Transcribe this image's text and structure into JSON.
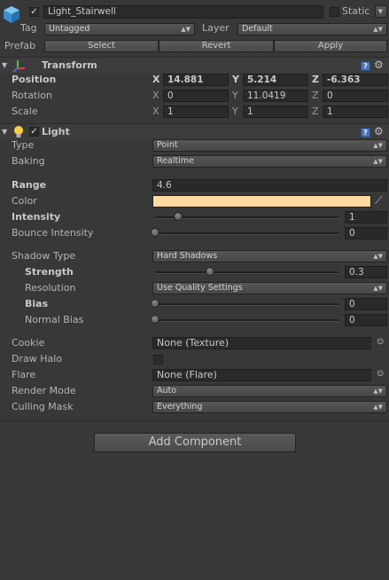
{
  "header": {
    "object_name": "Light_Stairwell",
    "static_label": "Static",
    "tag_label": "Tag",
    "tag_value": "Untagged",
    "layer_label": "Layer",
    "layer_value": "Default",
    "prefab_label": "Prefab",
    "prefab_buttons": [
      "Select",
      "Revert",
      "Apply"
    ]
  },
  "transform": {
    "title": "Transform",
    "rows": [
      {
        "label": "Position",
        "x": "14.881",
        "y": "5.214",
        "z": "-6.363"
      },
      {
        "label": "Rotation",
        "x": "0",
        "y": "11.0419",
        "z": "0"
      },
      {
        "label": "Scale",
        "x": "1",
        "y": "1",
        "z": "1"
      }
    ],
    "axes": [
      "X",
      "Y",
      "Z"
    ]
  },
  "light": {
    "title": "Light",
    "type_label": "Type",
    "type_value": "Point",
    "baking_label": "Baking",
    "baking_value": "Realtime",
    "range_label": "Range",
    "range_value": "4.6",
    "color_label": "Color",
    "color_value": "#ffd9a0",
    "intensity_label": "Intensity",
    "intensity_value": "1",
    "intensity_level": 0.125,
    "bounce_label": "Bounce Intensity",
    "bounce_value": "0",
    "bounce_level": 0,
    "shadow_type_label": "Shadow Type",
    "shadow_type_value": "Hard Shadows",
    "strength_label": "Strength",
    "strength_value": "0.3",
    "strength_level": 0.3,
    "resolution_label": "Resolution",
    "resolution_value": "Use Quality Settings",
    "bias_label": "Bias",
    "bias_value": "0",
    "bias_level": 0,
    "normal_bias_label": "Normal Bias",
    "normal_bias_value": "0",
    "normal_bias_level": 0,
    "cookie_label": "Cookie",
    "cookie_value": "None (Texture)",
    "draw_halo_label": "Draw Halo",
    "flare_label": "Flare",
    "flare_value": "None (Flare)",
    "render_mode_label": "Render Mode",
    "render_mode_value": "Auto",
    "culling_mask_label": "Culling Mask",
    "culling_mask_value": "Everything"
  },
  "add_component_label": "Add Component",
  "icons": {
    "object": "cube-icon",
    "transform": "transform-axes-icon",
    "light": "bulb-icon",
    "help": "help-icon",
    "gear": "gear-icon"
  }
}
